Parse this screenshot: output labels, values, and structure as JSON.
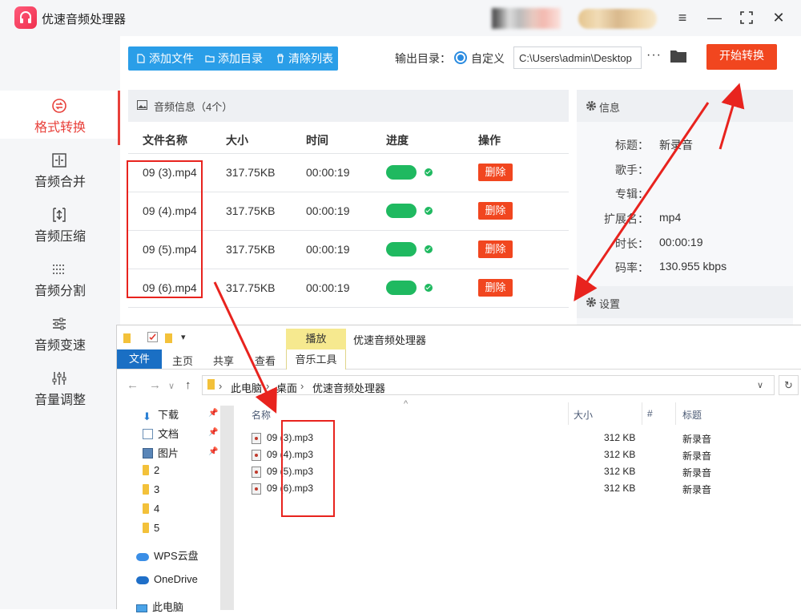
{
  "app": {
    "title": "优速音频处理器",
    "window_buttons": [
      "≡",
      "—",
      "⛶",
      "✕"
    ]
  },
  "sidebar": {
    "items": [
      {
        "label": "格式转换",
        "icon": "format-convert-icon",
        "active": true
      },
      {
        "label": "音频合并",
        "icon": "merge-icon"
      },
      {
        "label": "音频压缩",
        "icon": "compress-icon"
      },
      {
        "label": "音频分割",
        "icon": "split-icon"
      },
      {
        "label": "音频变速",
        "icon": "speed-icon"
      },
      {
        "label": "音量调整",
        "icon": "volume-icon"
      }
    ]
  },
  "toolbar": {
    "add_file": "添加文件",
    "add_folder": "添加目录",
    "clear_list": "清除列表",
    "output_label": "输出目录：",
    "custom_label": "自定义",
    "output_path": "C:\\Users\\admin\\Desktop",
    "more": "···",
    "start": "开始转换"
  },
  "file_list": {
    "header": "音频信息（4个）",
    "columns": [
      "文件名称",
      "大小",
      "时间",
      "进度",
      "操作"
    ],
    "rows": [
      {
        "name": "09 (3).mp4",
        "size": "317.75KB",
        "time": "00:00:19",
        "action": "删除"
      },
      {
        "name": "09 (4).mp4",
        "size": "317.75KB",
        "time": "00:00:19",
        "action": "删除"
      },
      {
        "name": "09 (5).mp4",
        "size": "317.75KB",
        "time": "00:00:19",
        "action": "删除"
      },
      {
        "name": "09 (6).mp4",
        "size": "317.75KB",
        "time": "00:00:19",
        "action": "删除"
      }
    ]
  },
  "info_panel": {
    "header": "信息",
    "fields": [
      {
        "key": "标题：",
        "value": "新录音"
      },
      {
        "key": "歌手：",
        "value": ""
      },
      {
        "key": "专辑：",
        "value": ""
      },
      {
        "key": "扩展名：",
        "value": "mp4"
      },
      {
        "key": "时长：",
        "value": "00:00:19"
      },
      {
        "key": "码率：",
        "value": "130.955 kbps"
      }
    ],
    "settings_header": "设置"
  },
  "explorer": {
    "ribbon_tabs": [
      "文件",
      "主页",
      "共享",
      "查看"
    ],
    "contextual_tab": "播放",
    "contextual_group": "音乐工具",
    "window_title": "优速音频处理器",
    "breadcrumb": [
      "此电脑",
      "桌面",
      "优速音频处理器"
    ],
    "tree": [
      {
        "label": "下载",
        "icon": "download-icon",
        "pinned": true
      },
      {
        "label": "文档",
        "icon": "document-icon",
        "pinned": true
      },
      {
        "label": "图片",
        "icon": "picture-icon",
        "pinned": true
      },
      {
        "label": "2",
        "icon": "folder-icon"
      },
      {
        "label": "3",
        "icon": "folder-icon"
      },
      {
        "label": "4",
        "icon": "folder-icon"
      },
      {
        "label": "5",
        "icon": "folder-icon"
      },
      {
        "label": "WPS云盘",
        "icon": "wps-cloud-icon"
      },
      {
        "label": "OneDrive",
        "icon": "onedrive-icon"
      },
      {
        "label": "此电脑",
        "icon": "computer-icon"
      }
    ],
    "columns": [
      "名称",
      "大小",
      "#",
      "标题"
    ],
    "files": [
      {
        "name": "09 (3).mp3",
        "size": "312 KB",
        "title": "新录音"
      },
      {
        "name": "09 (4).mp3",
        "size": "312 KB",
        "title": "新录音"
      },
      {
        "name": "09 (5).mp3",
        "size": "312 KB",
        "title": "新录音"
      },
      {
        "name": "09 (6).mp3",
        "size": "312 KB",
        "title": "新录音"
      }
    ]
  },
  "colors": {
    "accent_red": "#f1461f",
    "toolbar_blue": "#2a9ee8",
    "progress_green": "#1fb960",
    "annotation_red": "#e8231e",
    "explorer_file_tab": "#1a6fc4",
    "explorer_play_tab": "#f6e98f"
  }
}
